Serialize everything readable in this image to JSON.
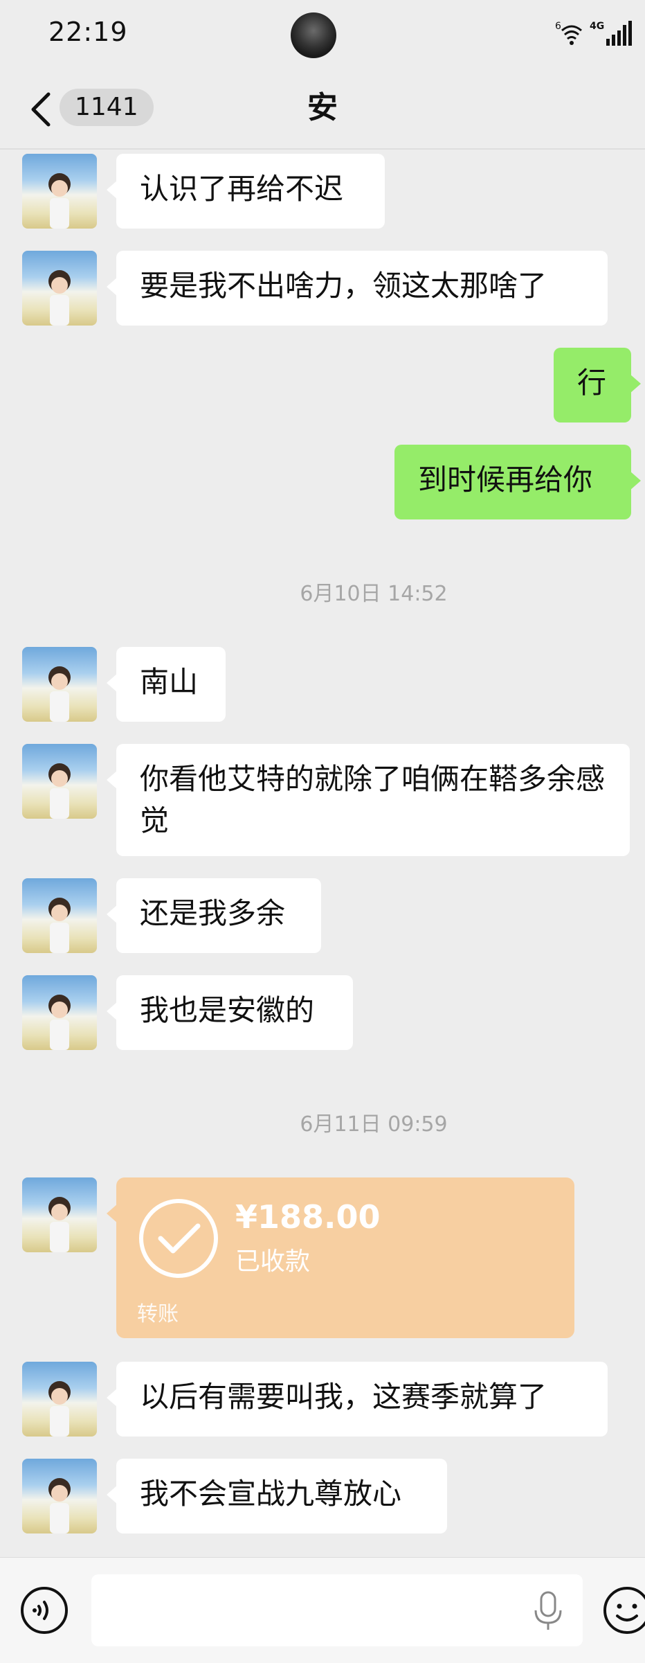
{
  "status_bar": {
    "time": "22:19",
    "wifi_badge": "6",
    "network": "4G"
  },
  "nav": {
    "back_badge": "1141",
    "title": "安",
    "back_icon": "chevron-left-icon"
  },
  "messages": [
    {
      "side": "left",
      "text": "认识了再给不迟"
    },
    {
      "side": "left",
      "text": "要是我不出啥力，领这太那啥了"
    },
    {
      "side": "right",
      "text": "行"
    },
    {
      "side": "right",
      "text": "到时候再给你"
    },
    {
      "side": "left",
      "text": "南山"
    },
    {
      "side": "left",
      "text": "你看他艾特的就除了咱俩在鞳多余感觉"
    },
    {
      "side": "left",
      "text": "还是我多余"
    },
    {
      "side": "left",
      "text": "我也是安徽的"
    },
    {
      "side": "left",
      "text": "以后有需要叫我，这赛季就算了"
    },
    {
      "side": "left",
      "text": "我不会宣战九尊放心"
    }
  ],
  "timestamps": [
    "6月10日 14:52",
    "6月11日 09:59"
  ],
  "transfer": {
    "amount": "¥188.00",
    "status": "已收款",
    "label": "转账",
    "color": "#f7cfa1"
  },
  "colors": {
    "background": "#ededed",
    "self_bubble": "#95ec69",
    "other_bubble": "#ffffff"
  }
}
